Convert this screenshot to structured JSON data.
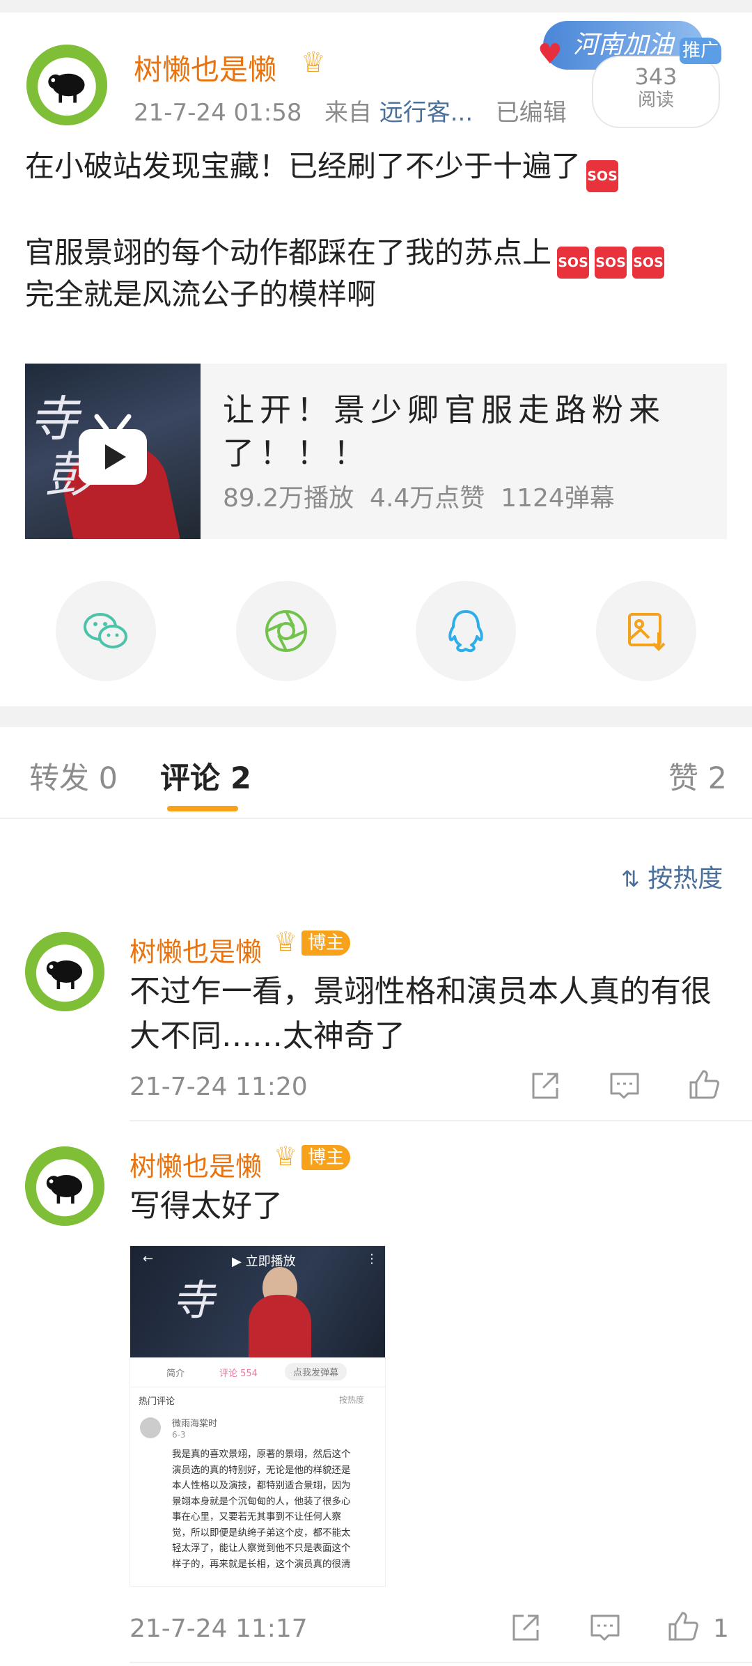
{
  "post": {
    "author": "树懒也是懒",
    "time": "21-7-24 01:58",
    "source_prefix": "来自",
    "source": "远行客...",
    "edited": "已编辑",
    "line1": "在小破站发现宝藏！已经刷了不少于十遍了",
    "line2": "官服景翊的每个动作都踩在了我的苏点上",
    "line3": "完全就是风流公子的模样啊",
    "sos": "SOS"
  },
  "promo": {
    "brand": "河南加油",
    "tag": "推广",
    "count": "343",
    "count_label": "阅读"
  },
  "video": {
    "title_line1": "让开！景少卿官服走路粉来",
    "title_line2": "了！！！",
    "stats": "89.2万播放  4.4万点赞  1124弹幕"
  },
  "share": [
    {
      "icon": "wechat-icon"
    },
    {
      "icon": "moments-icon"
    },
    {
      "icon": "qq-icon"
    },
    {
      "icon": "save-image-icon"
    }
  ],
  "tabs": {
    "repost": "转发 0",
    "comment": "评论 2",
    "like": "赞 2"
  },
  "sort_label": "按热度",
  "comments": [
    {
      "author": "树懒也是懒",
      "badge": "博主",
      "text_line1": "不过乍一看，景翊性格和演员本人真的有很",
      "text_line2": "大不同……太神奇了",
      "time": "21-7-24 11:20",
      "like_count": ""
    },
    {
      "author": "树懒也是懒",
      "badge": "博主",
      "text_line1": "写得太好了",
      "time": "21-7-24 11:17",
      "like_count": "1"
    }
  ],
  "attached_screenshot": {
    "play_label": "立即播放",
    "tab_intro": "简介",
    "tab_comments": "评论 554",
    "tab_danmaku": "点我发弹幕",
    "hot_comments": "热门评论",
    "sort": "按热度",
    "commenter": "微雨海棠时",
    "commenter_date": "6-3",
    "lines": [
      "我是真的喜欢景翊，原著的景翊，然后这个",
      "演员选的真的特别好，无论是他的样貌还是",
      "本人性格以及演技，都特别适合景翊，因为",
      "景翊本身就是个沉甸甸的人，他装了很多心",
      "事在心里，又要若无其事到不让任何人察",
      "觉，所以即便是纨绔子弟这个皮，都不能太",
      "轻太浮了，能让人察觉到他不只是表面这个",
      "样子的，再来就是长相，这个演员真的很清"
    ]
  }
}
